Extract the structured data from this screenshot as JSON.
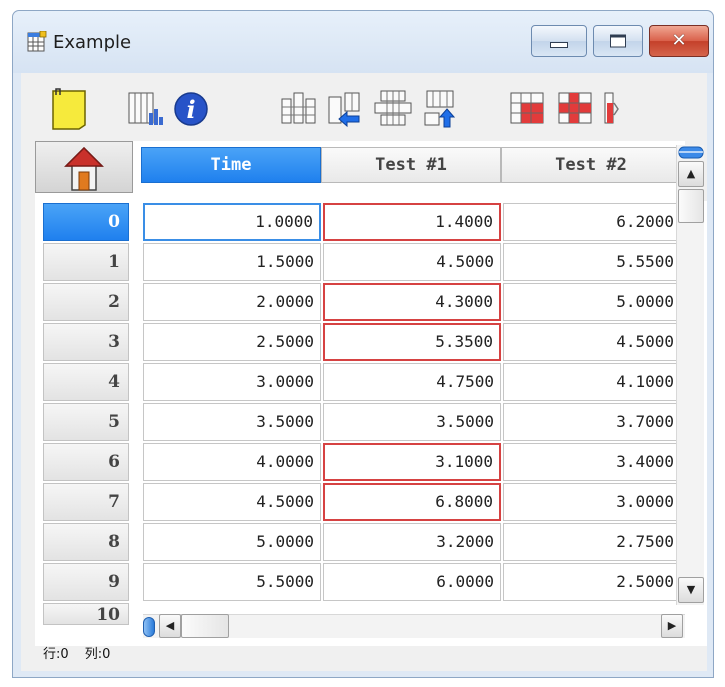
{
  "window": {
    "title": "Example"
  },
  "caption": {
    "close_glyph": "✕"
  },
  "toolbar": {
    "icons": [
      "new-sheet-icon",
      "chart-icon",
      "info-icon",
      "columns-icon",
      "insert-left-icon",
      "rows-icon",
      "insert-up-icon",
      "table-red-icon",
      "table-red-alt-icon",
      "more-icon"
    ]
  },
  "grid": {
    "columns": [
      "Time",
      "Test #1",
      "Test #2"
    ],
    "row_labels": [
      "0",
      "1",
      "2",
      "3",
      "4",
      "5",
      "6",
      "7",
      "8",
      "9",
      "10"
    ],
    "rows": [
      [
        "1.0000",
        "1.4000",
        "6.2000"
      ],
      [
        "1.5000",
        "4.5000",
        "5.5500"
      ],
      [
        "2.0000",
        "4.3000",
        "5.0000"
      ],
      [
        "2.5000",
        "5.3500",
        "4.5000"
      ],
      [
        "3.0000",
        "4.7500",
        "4.1000"
      ],
      [
        "3.5000",
        "3.5000",
        "3.7000"
      ],
      [
        "4.0000",
        "3.1000",
        "3.4000"
      ],
      [
        "4.5000",
        "6.8000",
        "3.0000"
      ],
      [
        "5.0000",
        "3.2000",
        "2.7500"
      ],
      [
        "5.5000",
        "6.0000",
        "2.5000"
      ]
    ],
    "flagged_test1_rows": [
      0,
      2,
      3,
      6,
      7
    ],
    "selected_cell": "Time row 0",
    "flag_color": "#d64242",
    "accent_color": "#1f80ee"
  },
  "scrollbars": {
    "up_arrow": "▲",
    "down_arrow": "▼",
    "left_arrow": "◀",
    "right_arrow": "▶",
    "column_nav": "⌃⌄"
  },
  "status": {
    "row": "行:0",
    "col": "列:0"
  }
}
